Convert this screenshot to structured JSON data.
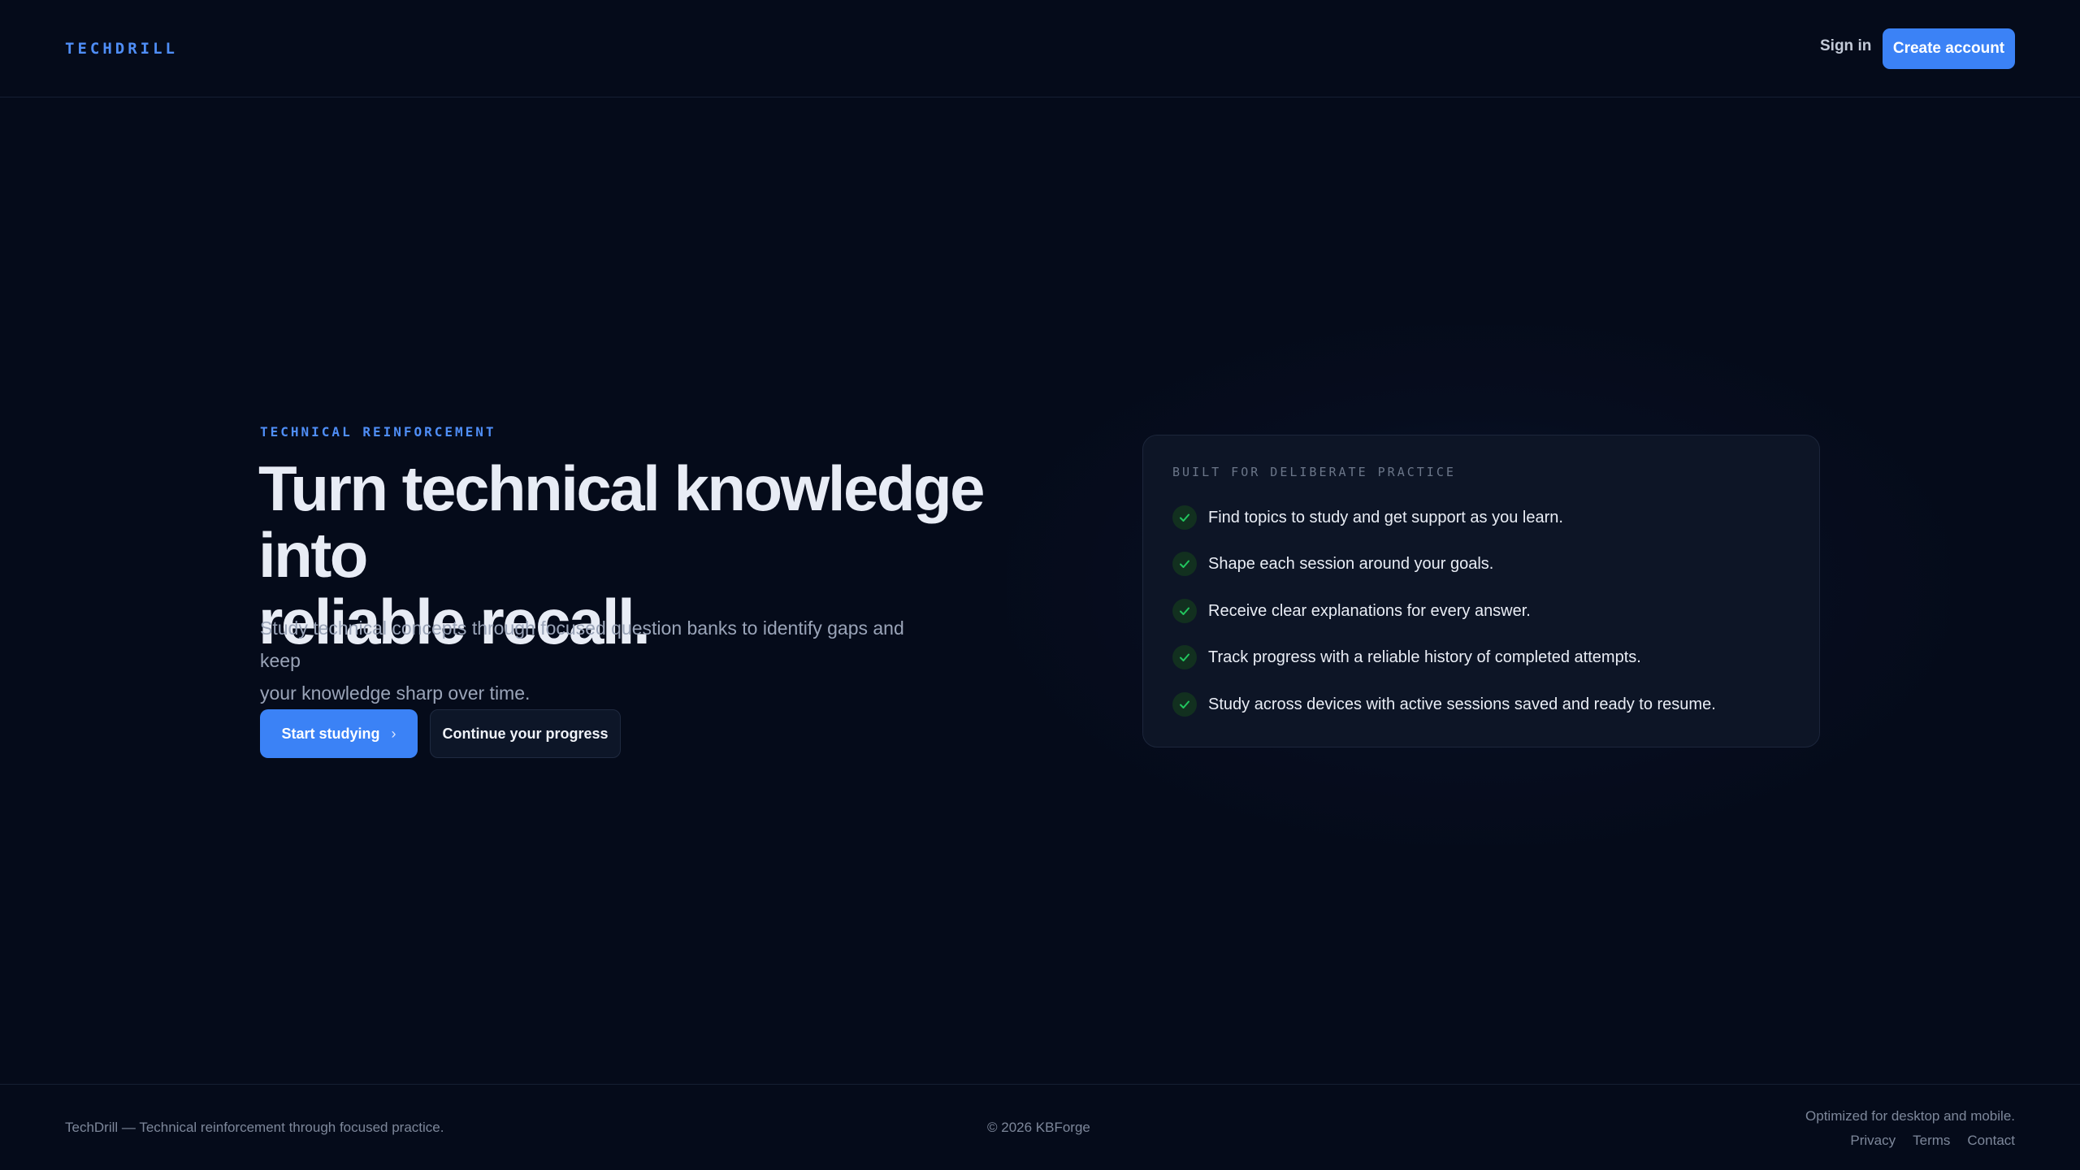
{
  "header": {
    "logo": "TECHDRILL",
    "signin_label": "Sign in",
    "create_account_label": "Create account"
  },
  "hero": {
    "eyebrow": "TECHNICAL REINFORCEMENT",
    "headline_line1": "Turn technical knowledge into",
    "headline_line2": "reliable recall.",
    "subtitle_line1": "Study technical concepts through focused question banks to identify gaps and keep",
    "subtitle_line2": "your knowledge sharp over time.",
    "start_label": "Start studying",
    "start_icon": "chevron-right-icon",
    "continue_label": "Continue your progress"
  },
  "card": {
    "title": "BUILT FOR DELIBERATE PRACTICE",
    "check_icon": "check-icon",
    "items": [
      "Find topics to study and get support as you learn.",
      "Shape each session around your goals.",
      "Receive clear explanations for every answer.",
      "Track progress with a reliable history of completed attempts.",
      "Study across devices with active sessions saved and ready to resume."
    ]
  },
  "footer": {
    "tagline": "TechDrill — Technical reinforcement through focused practice.",
    "copyright": "© 2026 KBForge",
    "optimized": "Optimized for desktop and mobile.",
    "links": [
      "Privacy",
      "Terms",
      "Contact"
    ]
  },
  "colors": {
    "background": "#050b1a",
    "accent": "#3b82f6",
    "success": "#22c55e"
  }
}
